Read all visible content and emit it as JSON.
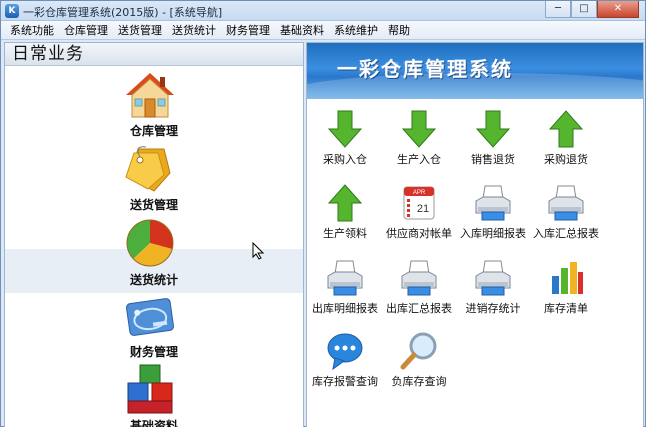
{
  "window": {
    "title": "一彩仓库管理系统(2015版) - [系统导航]",
    "app_icon_letter": "K",
    "minimize_glyph": "─",
    "maximize_glyph": "□",
    "close_glyph": "✕"
  },
  "menu": [
    "系统功能",
    "仓库管理",
    "送货管理",
    "送货统计",
    "财务管理",
    "基础资料",
    "系统维护",
    "帮助"
  ],
  "left_panel": {
    "title": "日常业务",
    "items": [
      {
        "label": "仓库管理",
        "icon": "house-icon"
      },
      {
        "label": "送货管理",
        "icon": "tags-icon"
      },
      {
        "label": "送货统计",
        "icon": "pie-chart-icon"
      },
      {
        "label": "财务管理",
        "icon": "bank-card-icon"
      },
      {
        "label": "基础资料",
        "icon": "cubes-icon"
      }
    ]
  },
  "banner": {
    "title": "一彩仓库管理系统"
  },
  "functions": [
    {
      "label": "采购入仓",
      "icon": "green-down-arrow-icon"
    },
    {
      "label": "生产入仓",
      "icon": "green-down-arrow-icon"
    },
    {
      "label": "销售退货",
      "icon": "green-down-arrow-icon"
    },
    {
      "label": "采购退货",
      "icon": "green-up-arrow-icon"
    },
    {
      "label": "生产领料",
      "icon": "green-up-arrow-icon"
    },
    {
      "label": "供应商对帐单",
      "icon": "calendar-icon"
    },
    {
      "label": "入库明细报表",
      "icon": "printer-icon"
    },
    {
      "label": "入库汇总报表",
      "icon": "printer-icon"
    },
    {
      "label": "出库明细报表",
      "icon": "printer-icon"
    },
    {
      "label": "出库汇总报表",
      "icon": "printer-icon"
    },
    {
      "label": "进销存统计",
      "icon": "printer-icon"
    },
    {
      "label": "库存清单",
      "icon": "bar-chart-icon"
    },
    {
      "label": "库存报警查询",
      "icon": "speech-bubble-icon"
    },
    {
      "label": "负库存查询",
      "icon": "magnifier-icon"
    }
  ],
  "calendar_icon": {
    "month": "APR",
    "day": "21"
  },
  "colors": {
    "accent_blue": "#2a78cc",
    "arrow_green": "#4fb02c"
  }
}
